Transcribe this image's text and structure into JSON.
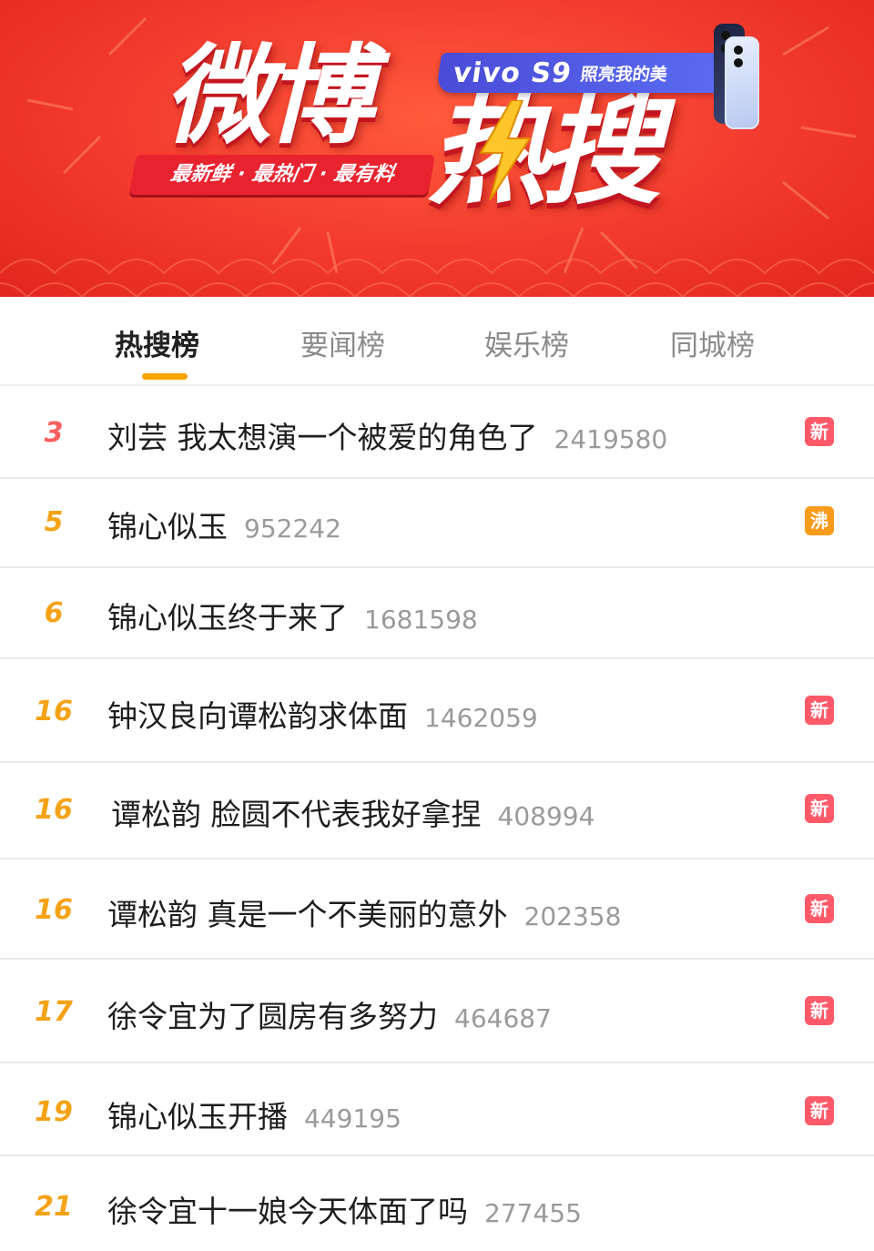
{
  "banner": {
    "title_main": "微博",
    "title_hot": "热搜",
    "tagline": "最新鲜 · 最热门 · 最有料",
    "sponsor_brand": "vivo S9",
    "sponsor_slogan": "照亮我的美",
    "colors": {
      "banner_red": "#f23a2e",
      "sponsor_blue": "#5b6bf2",
      "bolt_yellow": "#ffc629"
    }
  },
  "tabs": [
    {
      "label": "热搜榜",
      "active": true
    },
    {
      "label": "要闻榜",
      "active": false
    },
    {
      "label": "娱乐榜",
      "active": false
    },
    {
      "label": "同城榜",
      "active": false
    }
  ],
  "list": [
    {
      "rank": "3",
      "topic": "刘芸 我太想演一个被爱的角色了",
      "count": "2419580",
      "badge": "新"
    },
    {
      "rank": "5",
      "topic": "锦心似玉",
      "count": "952242",
      "badge": "沸"
    },
    {
      "rank": "6",
      "topic": "锦心似玉终于来了",
      "count": "1681598",
      "badge": ""
    },
    {
      "rank": "16",
      "topic": "钟汉良向谭松韵求体面",
      "count": "1462059",
      "badge": "新"
    },
    {
      "rank": "16",
      "topic": "谭松韵 脸圆不代表我好拿捏",
      "count": "408994",
      "badge": "新"
    },
    {
      "rank": "16",
      "topic": "谭松韵 真是一个不美丽的意外",
      "count": "202358",
      "badge": "新"
    },
    {
      "rank": "17",
      "topic": "徐令宜为了圆房有多努力",
      "count": "464687",
      "badge": "新"
    },
    {
      "rank": "19",
      "topic": "锦心似玉开播",
      "count": "449195",
      "badge": "新"
    },
    {
      "rank": "21",
      "topic": "徐令宜十一娘今天体面了吗",
      "count": "277455",
      "badge": ""
    }
  ],
  "colors": {
    "rank_top": "#f86060",
    "rank": "#f5a316",
    "badge_new": "#ff5a6a",
    "badge_boil": "#f89b1a",
    "tab_indicator": "#f7a300"
  }
}
